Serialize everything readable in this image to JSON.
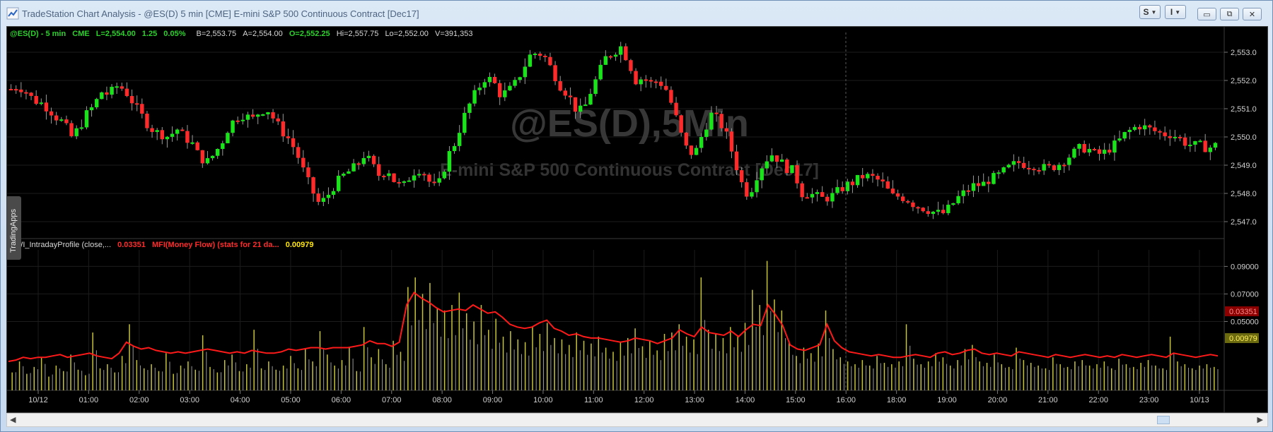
{
  "window": {
    "title": "TradeStation Chart Analysis - @ES(D) 5 min [CME] E-mini S&P 500 Continuous Contract [Dec17]",
    "buttons": {
      "s_menu": "S",
      "i_menu": "I",
      "minimize": "▭",
      "restore": "⧉",
      "close": "✕"
    }
  },
  "side_tab": {
    "label": "TradingApps"
  },
  "header": {
    "symbol": "@ES(D) - 5 min",
    "exchange": "CME",
    "last": "L=2,554.00",
    "change": "1.25",
    "pct": "0.05%",
    "bid": "B=2,553.75",
    "ask": "A=2,554.00",
    "open": "O=2,552.25",
    "high": "Hi=2,557.75",
    "low": "Lo=2,552.00",
    "volume": "V=391,353"
  },
  "watermark": {
    "symbol": "@ES(D),5Min",
    "description": "E-mini S&P 500 Continuous Contract [Dec17]"
  },
  "indicator": {
    "name": "CWI_IntradayProfile (close,...",
    "value_red": "0.03351",
    "mfi_label": "MFI(Money Flow) (stats for 21 da...",
    "value_yellow": "0.00979",
    "last_red_box": "0.03351",
    "last_yellow_box": "0.00979"
  },
  "colors": {
    "up": "#19e419",
    "down": "#ff2b2b",
    "wick": "#9a9a9a",
    "mfi_line": "#ff1a1a",
    "volume_bars": "#c7c43a",
    "header_green": "#2bd22b",
    "grid": "#1c1c1c"
  },
  "chart_data": [
    {
      "type": "candlestick",
      "title": "@ES(D) - 5 min",
      "y_ticks": [
        "2,553.0",
        "2,552.0",
        "2,551.0",
        "2,550.0",
        "2,549.0",
        "2,548.0",
        "2,547.0"
      ],
      "ylim": [
        2546.4,
        2553.7
      ],
      "x_ticks": [
        "10/12",
        "01:00",
        "02:00",
        "03:00",
        "04:00",
        "05:00",
        "06:00",
        "07:00",
        "08:00",
        "09:00",
        "10:00",
        "11:00",
        "12:00",
        "13:00",
        "14:00",
        "15:00",
        "16:00",
        "18:00",
        "19:00",
        "20:00",
        "21:00",
        "22:00",
        "23:00",
        "10/13"
      ],
      "close_path": [
        2551.7,
        2551.8,
        2551.6,
        2551.3,
        2551.2,
        2551.0,
        2550.7,
        2550.5,
        2550.0,
        2550.3,
        2550.8,
        2551.1,
        2551.6,
        2551.5,
        2551.8,
        2551.7,
        2551.3,
        2550.9,
        2550.5,
        2550.2,
        2550.1,
        2550.0,
        2550.3,
        2550.0,
        2549.8,
        2549.3,
        2549.1,
        2549.4,
        2549.8,
        2550.4,
        2550.7,
        2550.8,
        2550.6,
        2550.9,
        2551.0,
        2550.6,
        2550.2,
        2549.9,
        2549.4,
        2548.7,
        2548.1,
        2547.6,
        2547.9,
        2548.3,
        2548.6,
        2548.8,
        2549.0,
        2549.4,
        2549.0,
        2548.6,
        2548.9,
        2548.4,
        2548.2,
        2548.6,
        2548.9,
        2548.7,
        2548.2,
        2548.4,
        2549.3,
        2549.8,
        2550.6,
        2551.2,
        2551.7,
        2552.1,
        2552.0,
        2551.5,
        2551.6,
        2551.9,
        2552.4,
        2552.9,
        2553.0,
        2552.8,
        2552.3,
        2551.8,
        2551.5,
        2551.0,
        2550.9,
        2551.6,
        2552.2,
        2552.8,
        2553.0,
        2553.2,
        2552.7,
        2552.0,
        2552.1,
        2551.9,
        2552.0,
        2551.7,
        2551.0,
        2550.1,
        2549.4,
        2549.5,
        2550.2,
        2550.8,
        2550.6,
        2550.1,
        2549.3,
        2548.4,
        2547.9,
        2548.6,
        2549.1,
        2549.4,
        2549.2,
        2548.9,
        2548.8,
        2548.0,
        2548.0,
        2547.9,
        2547.8,
        2547.9,
        2548.1,
        2548.3,
        2548.4,
        2548.6,
        2548.6,
        2548.5,
        2548.3,
        2547.9,
        2547.9,
        2547.8,
        2547.6,
        2547.5,
        2547.4,
        2547.3,
        2547.3,
        2547.6,
        2547.9,
        2548.1,
        2548.3,
        2548.3,
        2548.5,
        2548.6,
        2548.8,
        2549.0,
        2549.1,
        2549.0,
        2549.0,
        2548.9,
        2548.9,
        2549.0,
        2549.2,
        2549.4,
        2549.6,
        2549.6,
        2549.4,
        2549.4,
        2549.6,
        2549.8,
        2550.1,
        2550.3,
        2550.4,
        2550.3,
        2550.2,
        2550.1,
        2550.1,
        2550.0,
        2549.8,
        2549.7,
        2549.7,
        2549.6,
        2549.7
      ],
      "down_share": 0.45
    },
    {
      "type": "line",
      "title": "CWI_IntradayProfile (close,...",
      "y_ticks": [
        "0.09000",
        "0.07000",
        "0.05000"
      ],
      "ylim": [
        0.0,
        0.102
      ],
      "mfi_series": [
        0.021,
        0.022,
        0.024,
        0.023,
        0.024,
        0.024,
        0.025,
        0.026,
        0.024,
        0.025,
        0.026,
        0.027,
        0.025,
        0.024,
        0.023,
        0.027,
        0.035,
        0.032,
        0.03,
        0.031,
        0.029,
        0.028,
        0.027,
        0.028,
        0.027,
        0.028,
        0.029,
        0.03,
        0.029,
        0.028,
        0.027,
        0.028,
        0.027,
        0.029,
        0.028,
        0.027,
        0.027,
        0.028,
        0.03,
        0.029,
        0.03,
        0.031,
        0.031,
        0.03,
        0.031,
        0.031,
        0.031,
        0.032,
        0.033,
        0.036,
        0.034,
        0.034,
        0.032,
        0.035,
        0.062,
        0.071,
        0.067,
        0.064,
        0.06,
        0.057,
        0.058,
        0.059,
        0.058,
        0.062,
        0.059,
        0.056,
        0.057,
        0.053,
        0.048,
        0.046,
        0.045,
        0.046,
        0.049,
        0.051,
        0.045,
        0.043,
        0.04,
        0.041,
        0.039,
        0.038,
        0.038,
        0.037,
        0.036,
        0.035,
        0.036,
        0.038,
        0.037,
        0.036,
        0.034,
        0.036,
        0.038,
        0.044,
        0.041,
        0.039,
        0.046,
        0.042,
        0.041,
        0.04,
        0.043,
        0.039,
        0.044,
        0.048,
        0.047,
        0.062,
        0.055,
        0.047,
        0.033,
        0.03,
        0.029,
        0.031,
        0.033,
        0.048,
        0.036,
        0.031,
        0.028,
        0.027,
        0.026,
        0.025,
        0.026,
        0.025,
        0.024,
        0.024,
        0.025,
        0.026,
        0.025,
        0.024,
        0.027,
        0.028,
        0.026,
        0.027,
        0.029,
        0.03,
        0.027,
        0.026,
        0.027,
        0.026,
        0.025,
        0.028,
        0.027,
        0.026,
        0.025,
        0.024,
        0.026,
        0.025,
        0.024,
        0.025,
        0.026,
        0.025,
        0.024,
        0.025,
        0.024,
        0.026,
        0.025,
        0.024,
        0.025,
        0.026,
        0.025,
        0.024,
        0.027,
        0.026,
        0.025,
        0.024,
        0.025,
        0.026,
        0.025
      ],
      "volume_series": [
        0.013,
        0.021,
        0.012,
        0.017,
        0.024,
        0.01,
        0.018,
        0.014,
        0.026,
        0.015,
        0.011,
        0.042,
        0.016,
        0.019,
        0.013,
        0.025,
        0.048,
        0.022,
        0.016,
        0.019,
        0.014,
        0.027,
        0.012,
        0.018,
        0.021,
        0.015,
        0.04,
        0.017,
        0.013,
        0.022,
        0.026,
        0.014,
        0.019,
        0.044,
        0.016,
        0.021,
        0.015,
        0.018,
        0.025,
        0.016,
        0.03,
        0.021,
        0.043,
        0.026,
        0.018,
        0.022,
        0.031,
        0.014,
        0.046,
        0.024,
        0.03,
        0.019,
        0.036,
        0.028,
        0.075,
        0.082,
        0.07,
        0.078,
        0.06,
        0.058,
        0.062,
        0.071,
        0.056,
        0.05,
        0.062,
        0.044,
        0.052,
        0.039,
        0.043,
        0.037,
        0.035,
        0.046,
        0.041,
        0.049,
        0.038,
        0.037,
        0.033,
        0.042,
        0.036,
        0.034,
        0.039,
        0.031,
        0.028,
        0.035,
        0.038,
        0.045,
        0.032,
        0.036,
        0.029,
        0.041,
        0.042,
        0.048,
        0.039,
        0.037,
        0.082,
        0.044,
        0.041,
        0.038,
        0.046,
        0.04,
        0.049,
        0.073,
        0.062,
        0.094,
        0.066,
        0.058,
        0.036,
        0.025,
        0.031,
        0.027,
        0.034,
        0.058,
        0.03,
        0.024,
        0.021,
        0.019,
        0.022,
        0.018,
        0.025,
        0.02,
        0.019,
        0.021,
        0.048,
        0.023,
        0.019,
        0.021,
        0.027,
        0.024,
        0.018,
        0.022,
        0.03,
        0.033,
        0.021,
        0.02,
        0.026,
        0.019,
        0.017,
        0.031,
        0.022,
        0.02,
        0.018,
        0.016,
        0.024,
        0.019,
        0.017,
        0.021,
        0.022,
        0.018,
        0.019,
        0.021,
        0.016,
        0.023,
        0.019,
        0.017,
        0.02,
        0.022,
        0.018,
        0.016,
        0.039,
        0.021,
        0.019,
        0.016,
        0.018,
        0.019,
        0.017
      ]
    }
  ]
}
